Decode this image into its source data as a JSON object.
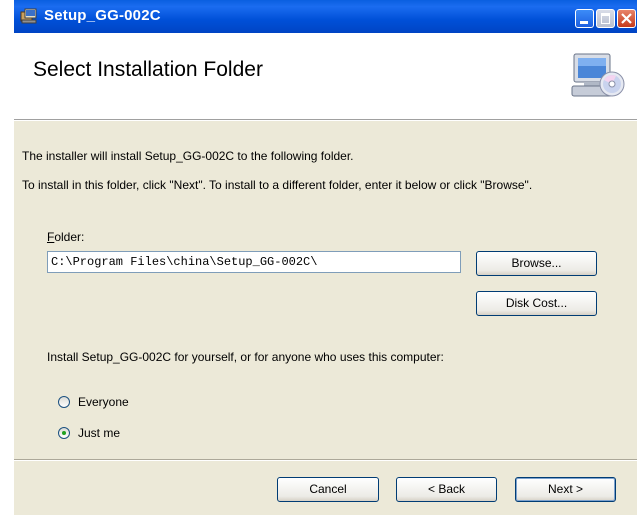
{
  "window": {
    "title": "Setup_GG-002C"
  },
  "banner": {
    "title": "Select Installation Folder"
  },
  "body": {
    "line1": "The installer will install Setup_GG-002C to the following folder.",
    "line2": "To install in this folder, click \"Next\". To install to a different folder, enter it below or click \"Browse\"."
  },
  "folder": {
    "label_mnemonic": "F",
    "label_rest": "older:",
    "value": "C:\\Program Files\\china\\Setup_GG-002C\\"
  },
  "buttons": {
    "browse": "Browse...",
    "disk_cost": "Disk Cost...",
    "cancel": "Cancel",
    "back": "< Back",
    "next": "Next >"
  },
  "install_for": {
    "prompt": "Install Setup_GG-002C for yourself, or for anyone who uses this computer:",
    "options": [
      {
        "label": "Everyone",
        "checked": false
      },
      {
        "label": "Just me",
        "checked": true
      }
    ]
  },
  "icons": [
    "setup-app-icon",
    "minimize-icon",
    "maximize-icon",
    "close-icon",
    "computer-cd-icon"
  ]
}
